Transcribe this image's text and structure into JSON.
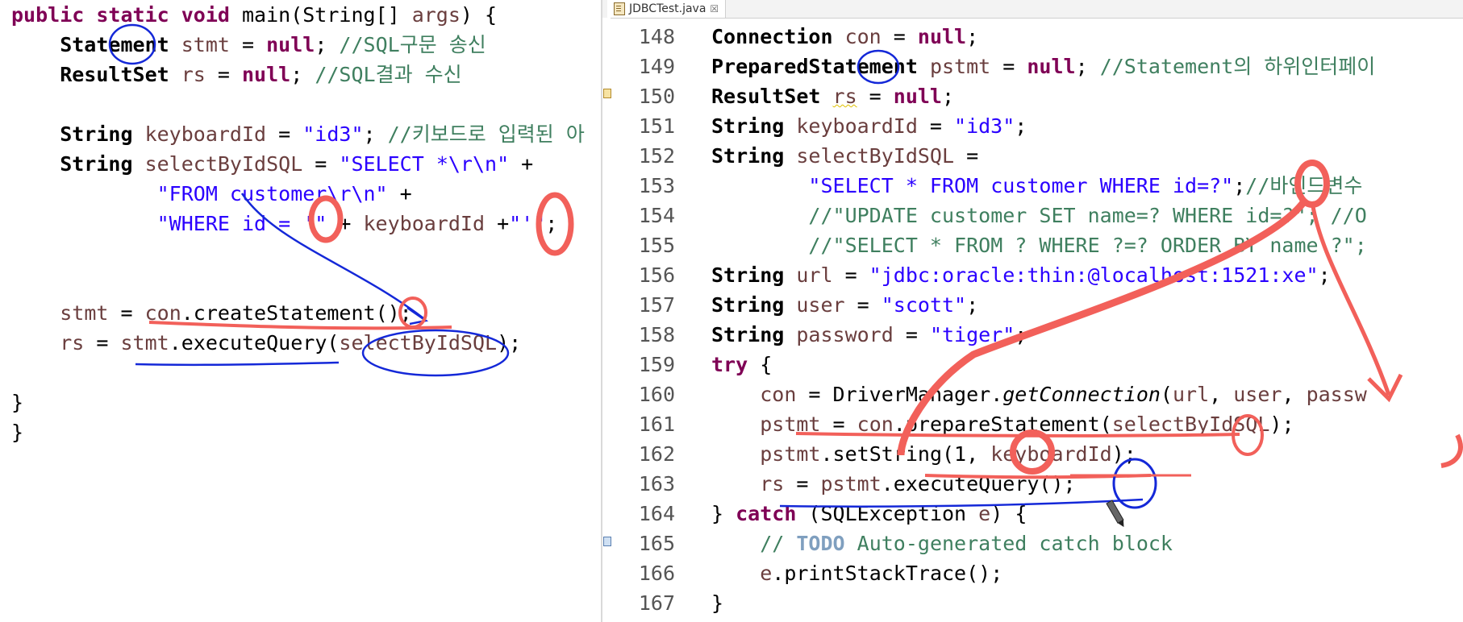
{
  "left_editor": {
    "lines": [
      [
        {
          "t": "public static void ",
          "c": "kw"
        },
        {
          "t": "main(String[] ",
          "c": ""
        },
        {
          "t": "args",
          "c": "var"
        },
        {
          "t": ") {",
          "c": ""
        }
      ],
      [
        {
          "t": "    Statement ",
          "c": "cls"
        },
        {
          "t": "stmt",
          "c": "var"
        },
        {
          "t": " = ",
          "c": ""
        },
        {
          "t": "null",
          "c": "kw"
        },
        {
          "t": "; ",
          "c": ""
        },
        {
          "t": "//SQL구문 송신",
          "c": "cmt"
        }
      ],
      [
        {
          "t": "    ResultSet ",
          "c": "cls"
        },
        {
          "t": "rs",
          "c": "var"
        },
        {
          "t": " = ",
          "c": ""
        },
        {
          "t": "null",
          "c": "kw"
        },
        {
          "t": "; ",
          "c": ""
        },
        {
          "t": "//SQL결과 수신",
          "c": "cmt"
        }
      ],
      [],
      [
        {
          "t": "    String ",
          "c": "cls"
        },
        {
          "t": "keyboardId",
          "c": "var"
        },
        {
          "t": " = ",
          "c": ""
        },
        {
          "t": "\"id3\"",
          "c": "str"
        },
        {
          "t": "; ",
          "c": ""
        },
        {
          "t": "//키보드로 입력된 아",
          "c": "cmt"
        }
      ],
      [
        {
          "t": "    String ",
          "c": "cls"
        },
        {
          "t": "selectByIdSQL",
          "c": "var"
        },
        {
          "t": " = ",
          "c": ""
        },
        {
          "t": "\"SELECT *\\r\\n\"",
          "c": "str"
        },
        {
          "t": " +",
          "c": ""
        }
      ],
      [
        {
          "t": "            ",
          "c": ""
        },
        {
          "t": "\"FROM customer\\r\\n\"",
          "c": "str"
        },
        {
          "t": " +",
          "c": ""
        }
      ],
      [
        {
          "t": "            ",
          "c": ""
        },
        {
          "t": "\"WHERE id = '\"",
          "c": "str"
        },
        {
          "t": " + ",
          "c": ""
        },
        {
          "t": "keyboardId",
          "c": "var"
        },
        {
          "t": " +",
          "c": ""
        },
        {
          "t": "\"'\"",
          "c": "str"
        },
        {
          "t": ";",
          "c": ""
        }
      ],
      [],
      [],
      [
        {
          "t": "    ",
          "c": ""
        },
        {
          "t": "stmt",
          "c": "var"
        },
        {
          "t": " = ",
          "c": ""
        },
        {
          "t": "con",
          "c": "var"
        },
        {
          "t": ".createStatement();",
          "c": ""
        }
      ],
      [
        {
          "t": "    ",
          "c": ""
        },
        {
          "t": "rs",
          "c": "var"
        },
        {
          "t": " = ",
          "c": ""
        },
        {
          "t": "stmt",
          "c": "var"
        },
        {
          "t": ".executeQuery(",
          "c": ""
        },
        {
          "t": "selectByIdSQL",
          "c": "var"
        },
        {
          "t": ");",
          "c": ""
        }
      ],
      [],
      [
        {
          "t": "}",
          "c": ""
        }
      ],
      [
        {
          "t": "}",
          "c": ""
        }
      ]
    ]
  },
  "right_editor": {
    "tab": {
      "label": "JDBCTest.java",
      "close": "☒"
    },
    "line_numbers": [
      "148",
      "149",
      "150",
      "151",
      "152",
      "153",
      "154",
      "155",
      "156",
      "157",
      "158",
      "159",
      "160",
      "161",
      "162",
      "163",
      "164",
      "165",
      "166",
      "167"
    ],
    "lines": [
      [
        {
          "t": "Connection ",
          "c": "cls"
        },
        {
          "t": "con",
          "c": "var"
        },
        {
          "t": " = ",
          "c": ""
        },
        {
          "t": "null",
          "c": "kw"
        },
        {
          "t": ";",
          "c": ""
        }
      ],
      [
        {
          "t": "PreparedStatement ",
          "c": "cls"
        },
        {
          "t": "pstmt",
          "c": "var"
        },
        {
          "t": " = ",
          "c": ""
        },
        {
          "t": "null",
          "c": "kw"
        },
        {
          "t": "; ",
          "c": ""
        },
        {
          "t": "//Statement의 하위인터페이",
          "c": "cmt"
        }
      ],
      [
        {
          "t": "ResultSet ",
          "c": "cls"
        },
        {
          "t": "rs",
          "c": "var sq"
        },
        {
          "t": " = ",
          "c": ""
        },
        {
          "t": "null",
          "c": "kw"
        },
        {
          "t": ";",
          "c": ""
        }
      ],
      [
        {
          "t": "String ",
          "c": "cls"
        },
        {
          "t": "keyboardId",
          "c": "var"
        },
        {
          "t": " = ",
          "c": ""
        },
        {
          "t": "\"id3\"",
          "c": "str"
        },
        {
          "t": ";",
          "c": ""
        }
      ],
      [
        {
          "t": "String ",
          "c": "cls"
        },
        {
          "t": "selectByIdSQL",
          "c": "var"
        },
        {
          "t": " =",
          "c": ""
        }
      ],
      [
        {
          "t": "        ",
          "c": ""
        },
        {
          "t": "\"SELECT * FROM customer WHERE id=?\"",
          "c": "str"
        },
        {
          "t": ";",
          "c": ""
        },
        {
          "t": "//바인드변수",
          "c": "cmt"
        }
      ],
      [
        {
          "t": "        ",
          "c": ""
        },
        {
          "t": "//\"UPDATE customer SET name=? WHERE id=?\"; //O",
          "c": "cmt"
        }
      ],
      [
        {
          "t": "        ",
          "c": ""
        },
        {
          "t": "//\"SELECT * FROM ? WHERE ?=? ORDER BY name ?\";",
          "c": "cmt"
        }
      ],
      [
        {
          "t": "String ",
          "c": "cls"
        },
        {
          "t": "url",
          "c": "var"
        },
        {
          "t": " = ",
          "c": ""
        },
        {
          "t": "\"jdbc:oracle:thin:@localhost:1521:xe\"",
          "c": "str"
        },
        {
          "t": ";",
          "c": ""
        }
      ],
      [
        {
          "t": "String ",
          "c": "cls"
        },
        {
          "t": "user",
          "c": "var"
        },
        {
          "t": " = ",
          "c": ""
        },
        {
          "t": "\"scott\"",
          "c": "str"
        },
        {
          "t": ";",
          "c": ""
        }
      ],
      [
        {
          "t": "String ",
          "c": "cls"
        },
        {
          "t": "password",
          "c": "var"
        },
        {
          "t": " = ",
          "c": ""
        },
        {
          "t": "\"tiger\"",
          "c": "str"
        },
        {
          "t": ";",
          "c": ""
        }
      ],
      [
        {
          "t": "try",
          "c": "kw"
        },
        {
          "t": " {",
          "c": ""
        }
      ],
      [
        {
          "t": "    ",
          "c": ""
        },
        {
          "t": "con",
          "c": "var"
        },
        {
          "t": " = DriverManager.",
          "c": ""
        },
        {
          "t": "getConnection",
          "c": "it"
        },
        {
          "t": "(",
          "c": ""
        },
        {
          "t": "url",
          "c": "var"
        },
        {
          "t": ", ",
          "c": ""
        },
        {
          "t": "user",
          "c": "var"
        },
        {
          "t": ", ",
          "c": ""
        },
        {
          "t": "passw",
          "c": "var"
        }
      ],
      [
        {
          "t": "    ",
          "c": ""
        },
        {
          "t": "pstmt",
          "c": "var"
        },
        {
          "t": " = ",
          "c": ""
        },
        {
          "t": "con",
          "c": "var"
        },
        {
          "t": ".prepareStatement(",
          "c": ""
        },
        {
          "t": "selectByIdSQL",
          "c": "var"
        },
        {
          "t": ");",
          "c": ""
        }
      ],
      [
        {
          "t": "    ",
          "c": ""
        },
        {
          "t": "pstmt",
          "c": "var"
        },
        {
          "t": ".setString(1, ",
          "c": ""
        },
        {
          "t": "keyboardId",
          "c": "var"
        },
        {
          "t": ");",
          "c": ""
        }
      ],
      [
        {
          "t": "    ",
          "c": ""
        },
        {
          "t": "rs",
          "c": "var"
        },
        {
          "t": " = ",
          "c": ""
        },
        {
          "t": "pstmt",
          "c": "var"
        },
        {
          "t": ".executeQuery();",
          "c": ""
        }
      ],
      [
        {
          "t": "} ",
          "c": ""
        },
        {
          "t": "catch",
          "c": "kw"
        },
        {
          "t": " (SQLException ",
          "c": ""
        },
        {
          "t": "e",
          "c": "var"
        },
        {
          "t": ") {",
          "c": ""
        }
      ],
      [
        {
          "t": "    ",
          "c": ""
        },
        {
          "t": "// ",
          "c": "cmt"
        },
        {
          "t": "TODO",
          "c": "todo"
        },
        {
          "t": " Auto-generated catch block",
          "c": "cmt"
        }
      ],
      [
        {
          "t": "    ",
          "c": ""
        },
        {
          "t": "e",
          "c": "var"
        },
        {
          "t": ".printStackTrace();",
          "c": ""
        }
      ],
      [
        {
          "t": "}",
          "c": ""
        }
      ]
    ]
  },
  "annotation_colors": {
    "red": "#f2605a",
    "blue": "#1428d8"
  }
}
